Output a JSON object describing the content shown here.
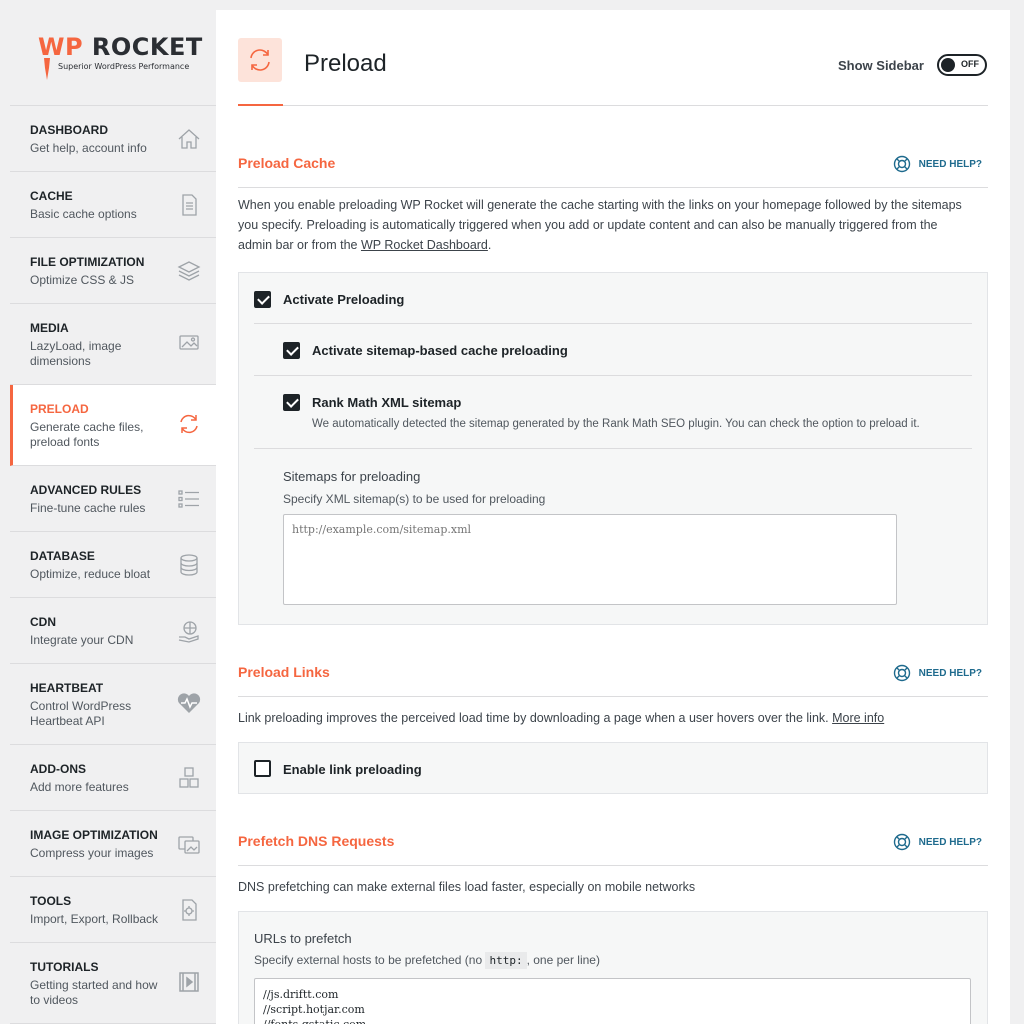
{
  "logo": {
    "wp": "WP",
    "rocket": "ROCKET",
    "tagline": "Superior WordPress Performance"
  },
  "sidebar": {
    "items": [
      {
        "title": "DASHBOARD",
        "sub": "Get help, account info",
        "icon": "home-icon"
      },
      {
        "title": "CACHE",
        "sub": "Basic cache options",
        "icon": "document-icon"
      },
      {
        "title": "FILE OPTIMIZATION",
        "sub": "Optimize CSS & JS",
        "icon": "layers-icon"
      },
      {
        "title": "MEDIA",
        "sub": "LazyLoad, image dimensions",
        "icon": "images-icon"
      },
      {
        "title": "PRELOAD",
        "sub": "Generate cache files, preload fonts",
        "icon": "refresh-icon"
      },
      {
        "title": "ADVANCED RULES",
        "sub": "Fine-tune cache rules",
        "icon": "list-icon"
      },
      {
        "title": "DATABASE",
        "sub": "Optimize, reduce bloat",
        "icon": "database-icon"
      },
      {
        "title": "CDN",
        "sub": "Integrate your CDN",
        "icon": "globe-hand-icon"
      },
      {
        "title": "HEARTBEAT",
        "sub": "Control WordPress Heartbeat API",
        "icon": "heartbeat-icon"
      },
      {
        "title": "ADD-ONS",
        "sub": "Add more features",
        "icon": "cubes-icon"
      },
      {
        "title": "IMAGE OPTIMIZATION",
        "sub": "Compress your images",
        "icon": "image-compress-icon"
      },
      {
        "title": "TOOLS",
        "sub": "Import, Export, Rollback",
        "icon": "tools-icon"
      },
      {
        "title": "TUTORIALS",
        "sub": "Getting started and how to videos",
        "icon": "video-icon"
      }
    ]
  },
  "header": {
    "title": "Preload",
    "toggle_label": "Show Sidebar",
    "toggle_state": "OFF"
  },
  "preload_cache": {
    "title": "Preload Cache",
    "help": "NEED HELP?",
    "desc_line1": "When you enable preloading WP Rocket will generate the cache starting with the links on your homepage followed by the sitemaps",
    "desc_line2": "you specify. Preloading is automatically triggered when you add or update content and can also be manually triggered from the",
    "desc_line3_pre": "admin bar or from the ",
    "desc_link": "WP Rocket Dashboard",
    "desc_line3_post": ".",
    "activate_label": "Activate Preloading",
    "sitemap_label": "Activate sitemap-based cache preloading",
    "rankmath_label": "Rank Math XML sitemap",
    "rankmath_sub": "We automatically detected the sitemap generated by the Rank Math SEO plugin. You can check the option to preload it.",
    "sitemaps_title": "Sitemaps for preloading",
    "sitemaps_sub": "Specify XML sitemap(s) to be used for preloading",
    "sitemaps_placeholder": "http://example.com/sitemap.xml"
  },
  "preload_links": {
    "title": "Preload Links",
    "help": "NEED HELP?",
    "desc": "Link preloading improves the perceived load time by downloading a page when a user hovers over the link. ",
    "more": "More info",
    "enable_label": "Enable link preloading"
  },
  "prefetch": {
    "title": "Prefetch DNS Requests",
    "help": "NEED HELP?",
    "desc": "DNS prefetching can make external files load faster, especially on mobile networks",
    "urls_title": "URLs to prefetch",
    "urls_sub_pre": "Specify external hosts to be prefetched (no ",
    "urls_code": "http:",
    "urls_sub_post": ", one per line)",
    "urls_value": "//js.driftt.com\n//script.hotjar.com\n//fonts.gstatic.com"
  },
  "colors": {
    "accent": "#f56640",
    "link_help": "#1e6a8d"
  }
}
